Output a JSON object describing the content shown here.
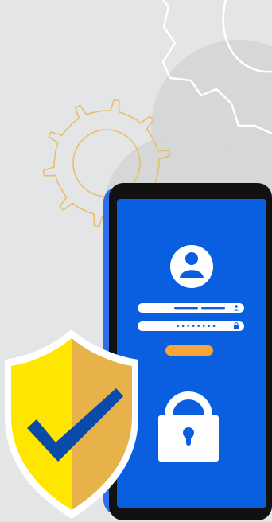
{
  "illustration": {
    "subject": "secure-mobile-login",
    "colors": {
      "background": "#e4e5e7",
      "background_blob": "#d6d7d9",
      "gear_white_outline": "#ffffff",
      "gear_gold_outline": "#e5c06b",
      "phone_body": "#111111",
      "phone_edge": "#2d6fe8",
      "screen": "#0a5ee0",
      "avatar": "#ffffff",
      "input_field": "#ffffff",
      "input_line": "#0a5ee0",
      "login_button": "#f7a53a",
      "lock": "#ffffff",
      "shield_left": "#ffe600",
      "shield_right": "#e7b24a",
      "shield_border": "#ffffff",
      "checkmark": "#0a4aa8"
    },
    "icons": {
      "user_avatar": "user-icon",
      "field_user": "person-icon",
      "field_password": "lock-icon",
      "big_lock": "padlock-icon",
      "shield": "shield-check-icon",
      "gears": "gear-icon"
    },
    "fields": {
      "password_mask": "••••••••"
    }
  }
}
